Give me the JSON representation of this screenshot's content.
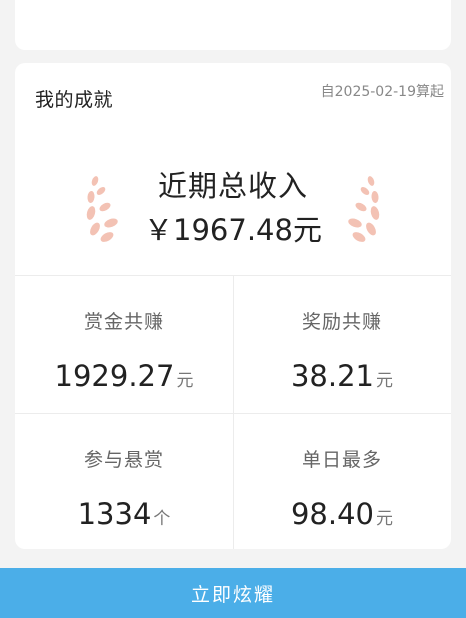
{
  "achievement": {
    "title": "我的成就",
    "since": "自2025-02-19算起",
    "total_label": "近期总收入",
    "total_value": "￥1967.48元"
  },
  "stats": [
    {
      "label": "赏金共赚",
      "value": "1929.27",
      "unit": "元"
    },
    {
      "label": "奖励共赚",
      "value": "38.21",
      "unit": "元"
    },
    {
      "label": "参与悬赏",
      "value": "1334",
      "unit": "个"
    },
    {
      "label": "单日最多",
      "value": "98.40",
      "unit": "元"
    }
  ],
  "cta": {
    "label": "立即炫耀"
  },
  "colors": {
    "accent": "#4baee8",
    "laurel": "#f0b8a8"
  },
  "icons": [
    "laurel-left-icon",
    "laurel-right-icon"
  ]
}
